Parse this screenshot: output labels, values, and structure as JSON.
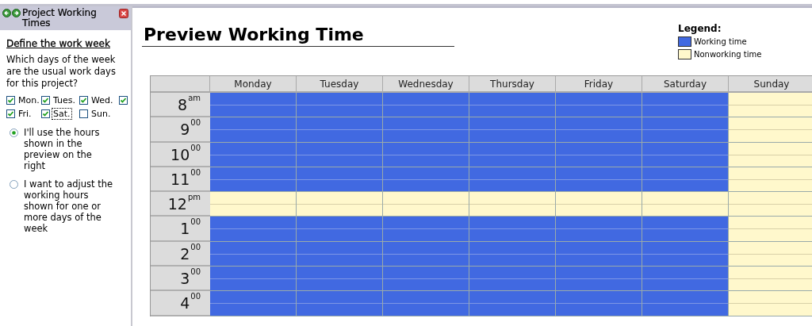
{
  "task_pane": {
    "title": "Project Working Times",
    "heading": "Define the work week",
    "question": "Which days of the week are the usual work days for this project?",
    "days": [
      {
        "label": "Mon.",
        "checked": true,
        "focused": false
      },
      {
        "label": "Tues.",
        "checked": true,
        "focused": false
      },
      {
        "label": "Wed.",
        "checked": true,
        "focused": false
      },
      {
        "checked": true,
        "focused": false
      },
      {
        "label": "Fri.",
        "checked": true,
        "focused": false
      },
      {
        "label": "Sat.",
        "checked": true,
        "focused": true
      },
      {
        "label": "Sun.",
        "checked": false,
        "focused": false
      }
    ],
    "options": [
      {
        "label": "I'll use the hours shown in the preview on the right",
        "selected": true
      },
      {
        "label": "I want to adjust the working hours shown for one or more days of the week",
        "selected": false
      }
    ]
  },
  "preview": {
    "title": "Preview Working Time",
    "legend": {
      "title": "Legend:",
      "items": [
        {
          "label": "Working time",
          "kind": "working"
        },
        {
          "label": "Nonworking time",
          "kind": "nonworking"
        }
      ]
    },
    "columns": [
      "Monday",
      "Tuesday",
      "Wednesday",
      "Thursday",
      "Friday",
      "Saturday",
      "Sunday"
    ],
    "rows": [
      {
        "time": "8$^{am}$",
        "working": [
          true,
          true,
          true,
          true,
          true,
          true,
          false
        ]
      },
      {
        "time": "9$^{00}$",
        "working": [
          true,
          true,
          true,
          true,
          true,
          true,
          false
        ]
      },
      {
        "time": "10$^{00}$",
        "working": [
          true,
          true,
          true,
          true,
          true,
          true,
          false
        ]
      },
      {
        "time": "11$^{00}$",
        "working": [
          true,
          true,
          true,
          true,
          true,
          true,
          false
        ]
      },
      {
        "time": "12$^{pm}$",
        "working": [
          false,
          false,
          false,
          false,
          false,
          false,
          false
        ]
      },
      {
        "time": "1$^{00}$",
        "working": [
          true,
          true,
          true,
          true,
          true,
          true,
          false
        ]
      },
      {
        "time": "2$^{00}$",
        "working": [
          true,
          true,
          true,
          true,
          true,
          true,
          false
        ]
      },
      {
        "time": "3$^{00}$",
        "working": [
          true,
          true,
          true,
          true,
          true,
          true,
          false
        ]
      },
      {
        "time": "4$^{00}$",
        "working": [
          true,
          true,
          true,
          true,
          true,
          true,
          false
        ]
      }
    ]
  }
}
